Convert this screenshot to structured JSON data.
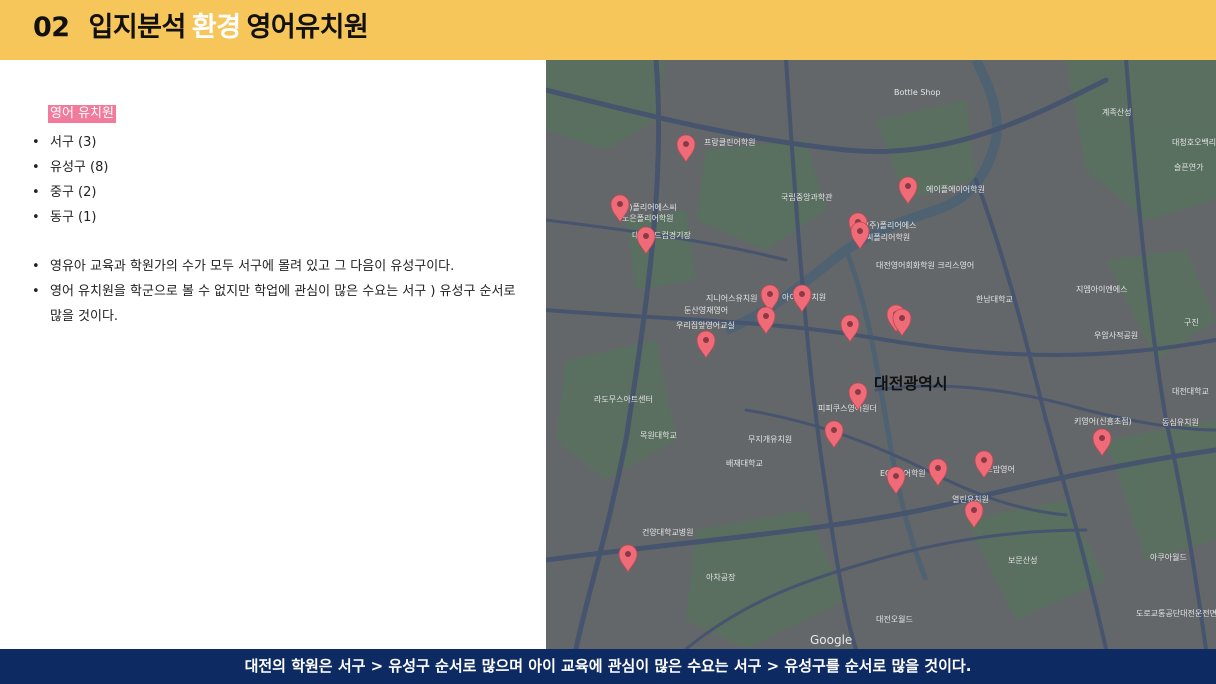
{
  "header": {
    "number": "02",
    "title_part1": "입지분석",
    "title_highlight": "환경",
    "title_part2": "영어유치원"
  },
  "left_panel": {
    "tag": "영어 유치원",
    "districts": [
      "서구 (3)",
      "유성구 (8)",
      "중구 (2)",
      "동구 (1)"
    ],
    "notes": [
      "영유아 교육과 학원가의 수가 모두 서구에 몰려 있고 그 다음이 유성구이다.",
      "영어 유치원을 학군으로 볼 수 없지만 학업에 관심이 많은 수요는 서구 ) 유성구 순서로 많을 것이다."
    ]
  },
  "map": {
    "city_label": "대전광역시",
    "pin_color": "#f06b78",
    "labels": [
      "프랑클린어학원",
      "Bottle Shop",
      "계족산성",
      "대청호오백리길",
      "슬픈연가",
      "에이플에이어학원",
      "국립중앙과학관",
      "수)폴리어에스씨",
      "노은폴리어학원",
      "대전월드컵경기장",
      "(주)폴리어에스",
      "씨폴리어학원",
      "대전영어회화학원 크리스영어",
      "지니어스유치원",
      "아이맘유치원",
      "한남대학교",
      "지엠아이엔에스",
      "둔산영재영어",
      "우리집앞영어교실",
      "우암사적공원",
      "구진",
      "라도무스아트센터",
      "피피쿠스영어원더",
      "대전대학교",
      "동심유치원",
      "무지개유치원",
      "목원대학교",
      "배재대학교",
      "ECC영어학원",
      "위드맘영어",
      "키영어(신흥초점)",
      "열린유치원",
      "건양대학교병원",
      "보문산성",
      "아쿠아월드",
      "대전오월드",
      "도로교통공단대전운전면허시험장",
      "아차공장"
    ],
    "pins": 21
  },
  "footer": {
    "text": "대전의 학원은 서구 > 유성구 순서로 많으며 아이 교육에 관심이 많은 수요는 서구 > 유성구를 순서로 많을 것이다."
  }
}
